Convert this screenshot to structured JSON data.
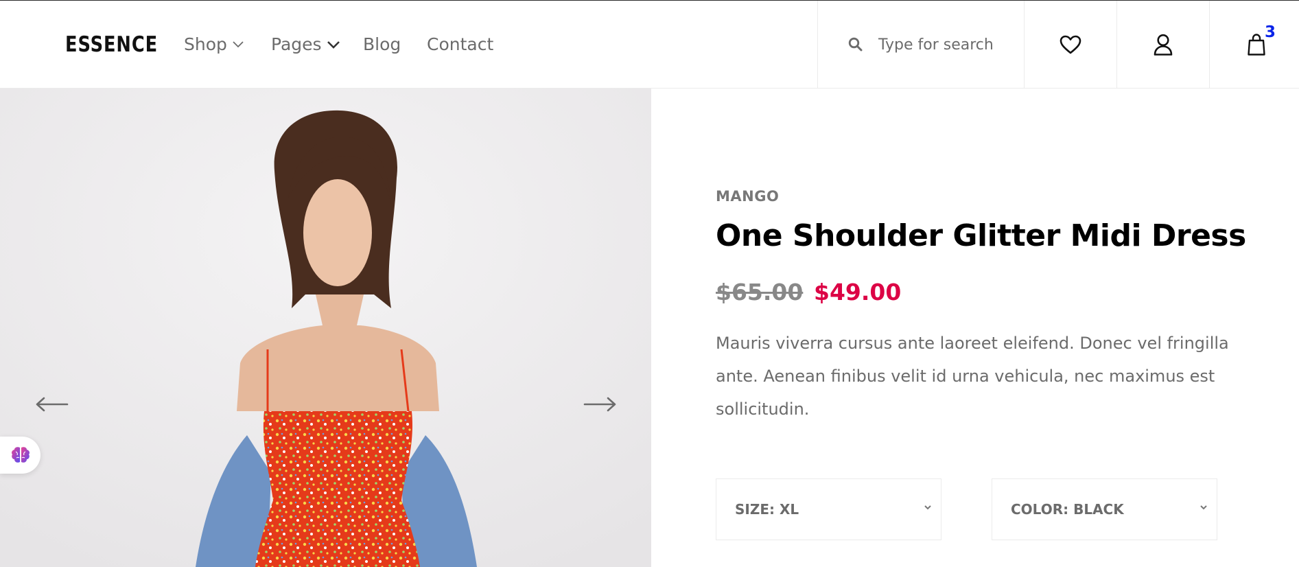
{
  "header": {
    "logo": "ESSENCE",
    "nav": [
      {
        "label": "Shop",
        "has_dropdown": true
      },
      {
        "label": "Pages",
        "has_dropdown": true
      },
      {
        "label": "Blog",
        "has_dropdown": false
      },
      {
        "label": "Contact",
        "has_dropdown": false
      }
    ],
    "search": {
      "placeholder": "Type for search",
      "value": ""
    },
    "icons": {
      "wishlist": "heart-icon",
      "account": "user-icon",
      "cart": "shopping-bag-icon"
    },
    "cart_count": "3"
  },
  "hero": {
    "image": "product-photo",
    "prev_icon": "arrow-left-icon",
    "next_icon": "arrow-right-icon"
  },
  "floating_helper": {
    "icon": "brain-icon"
  },
  "product": {
    "brand": "MANGO",
    "title": "One Shoulder Glitter Midi Dress",
    "old_price": "$65.00",
    "price": "$49.00",
    "description": "Mauris viverra cursus ante laoreet eleifend. Donec vel fringilla ante. Aenean finibus velit id urna vehicula, nec maximus est sollicitudin.",
    "size_select": "SIZE: XL",
    "color_select": "COLOR: BLACK"
  },
  "colors": {
    "sale_price": "#dc0345",
    "cart_badge": "#0a24e8"
  }
}
